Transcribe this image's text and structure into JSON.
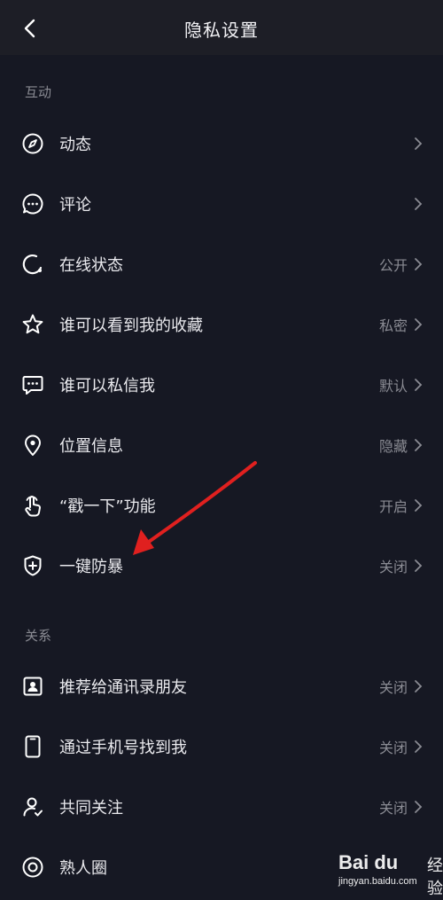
{
  "header": {
    "title": "隐私设置",
    "back_icon": "back-chevron-icon"
  },
  "sections": {
    "interaction": "互动",
    "relationship": "关系"
  },
  "rows": {
    "activity": {
      "label": "动态",
      "value": ""
    },
    "comments": {
      "label": "评论",
      "value": ""
    },
    "online": {
      "label": "在线状态",
      "value": "公开"
    },
    "favorites": {
      "label": "谁可以看到我的收藏",
      "value": "私密"
    },
    "dm": {
      "label": "谁可以私信我",
      "value": "默认"
    },
    "location": {
      "label": "位置信息",
      "value": "隐藏"
    },
    "poke": {
      "label": "“戳一下”功能",
      "value": "开启"
    },
    "anti_harass": {
      "label": "一键防暴",
      "value": "关闭"
    },
    "contacts": {
      "label": "推荐给通讯录朋友",
      "value": "关闭"
    },
    "phone": {
      "label": "通过手机号找到我",
      "value": "关闭"
    },
    "mutual": {
      "label": "共同关注",
      "value": "关闭"
    },
    "acquaintance": {
      "label": "熟人圈",
      "value": ""
    }
  },
  "watermark": {
    "logo": "Bai du",
    "text": "经验",
    "url": "jingyan.baidu.com"
  },
  "colors": {
    "background": "#161823",
    "header": "#1d1e26",
    "arrow": "#e0201f",
    "muted": "#8a8b93"
  }
}
